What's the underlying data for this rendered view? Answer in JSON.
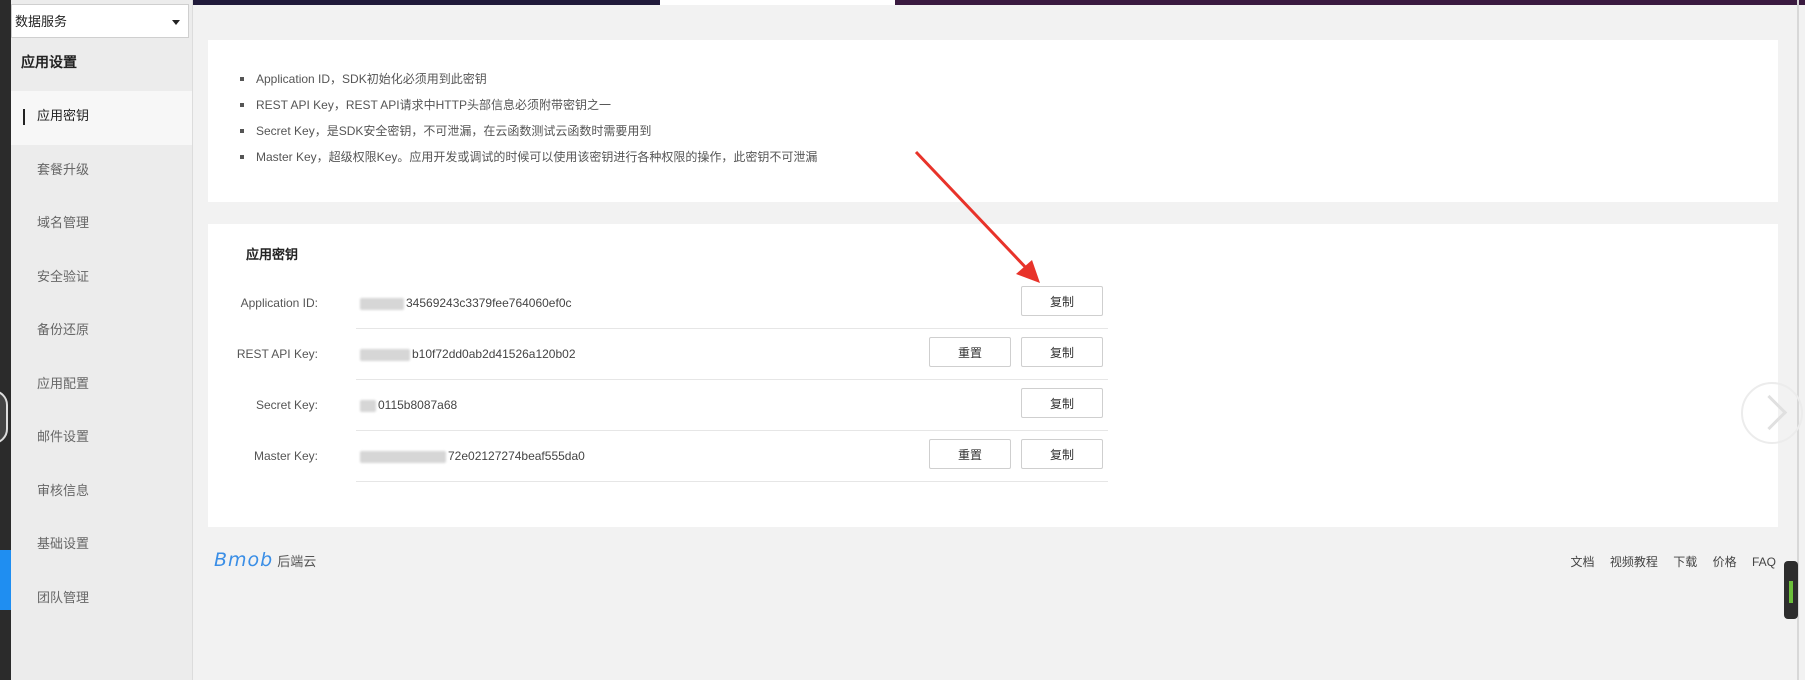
{
  "service_select": {
    "value": "数据服务"
  },
  "sidebar": {
    "title": "应用设置",
    "items": [
      {
        "label": "应用密钥",
        "active": true
      },
      {
        "label": "套餐升级"
      },
      {
        "label": "域名管理"
      },
      {
        "label": "安全验证"
      },
      {
        "label": "备份还原"
      },
      {
        "label": "应用配置"
      },
      {
        "label": "邮件设置"
      },
      {
        "label": "审核信息"
      },
      {
        "label": "基础设置"
      },
      {
        "label": "团队管理"
      }
    ]
  },
  "info": {
    "items": [
      "Application ID，SDK初始化必须用到此密钥",
      "REST API Key，REST API请求中HTTP头部信息必须附带密钥之一",
      "Secret Key，是SDK安全密钥，不可泄漏，在云函数测试云函数时需要用到",
      "Master Key，超级权限Key。应用开发或调试的时候可以使用该密钥进行各种权限的操作，此密钥不可泄漏"
    ]
  },
  "keys": {
    "title": "应用密钥",
    "rows": [
      {
        "label": "Application ID:",
        "value": "34569243c3379fee764060ef0c",
        "copy": "复制"
      },
      {
        "label": "REST API Key:",
        "value": "b10f72dd0ab2d41526a120b02",
        "reset": "重置",
        "copy": "复制"
      },
      {
        "label": "Secret Key:",
        "value": "0115b8087a68",
        "copy": "复制"
      },
      {
        "label": "Master Key:",
        "value": "72e02127274beaf555da0",
        "reset": "重置",
        "copy": "复制"
      }
    ]
  },
  "footer": {
    "brand": "Bmob",
    "brand_suffix": "后端云",
    "links": [
      "文档",
      "视频教程",
      "下载",
      "价格",
      "FAQ"
    ]
  },
  "colors": {
    "brand": "#3a8ee6",
    "annotation_arrow": "#e8332a",
    "active_indicator": "#222222"
  },
  "icons": {
    "select_caret": "caret-down-icon",
    "next": "chevron-right-icon",
    "annotation": "red-arrow-annotation"
  }
}
